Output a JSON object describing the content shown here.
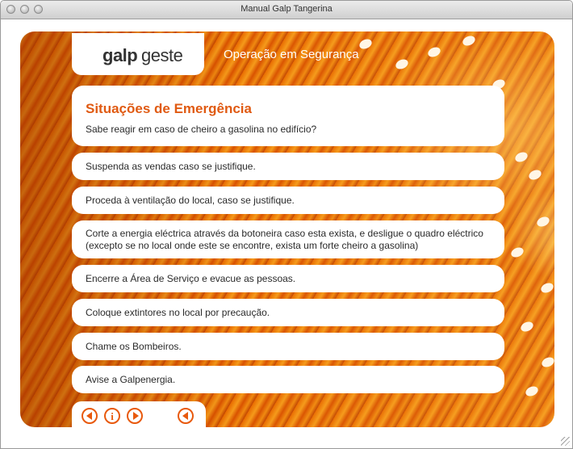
{
  "window": {
    "title": "Manual Galp Tangerina"
  },
  "logo": {
    "brand": "galp",
    "product": "geste"
  },
  "section": {
    "title": "Operação em Segurança"
  },
  "header": {
    "title": "Situações de Emergência",
    "subtitle": "Sabe reagir em caso de cheiro a gasolina no edifício?"
  },
  "steps": [
    "Suspenda as vendas caso se justifique.",
    "Proceda à ventilação do local, caso se justifique.",
    "Corte a energia eléctrica através da botoneira caso esta exista, e desligue o quadro eléctrico (excepto se no local onde este se encontre, exista um forte cheiro a gasolina)",
    "Encerre a Área de Serviço e evacue as pessoas.",
    "Coloque extintores no local por precaução.",
    "Chame os Bombeiros.",
    "Avise a Galpenergia."
  ],
  "icons": {
    "previous": "previous-icon",
    "info": "info-icon",
    "next": "next-icon",
    "back": "back-icon"
  },
  "colors": {
    "accent": "#e8590c",
    "title": "#e05a12"
  }
}
